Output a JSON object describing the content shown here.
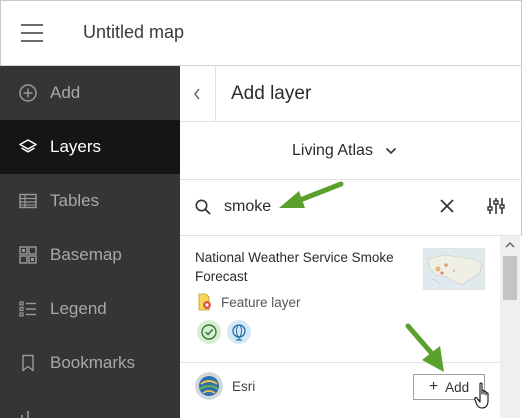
{
  "app": {
    "title": "Untitled map"
  },
  "sidebar": {
    "items": [
      {
        "label": "Add",
        "icon": "add-circle-icon",
        "active": false
      },
      {
        "label": "Layers",
        "icon": "layers-icon",
        "active": true
      },
      {
        "label": "Tables",
        "icon": "table-icon",
        "active": false
      },
      {
        "label": "Basemap",
        "icon": "basemap-icon",
        "active": false
      },
      {
        "label": "Legend",
        "icon": "legend-icon",
        "active": false
      },
      {
        "label": "Bookmarks",
        "icon": "bookmark-icon",
        "active": false
      }
    ]
  },
  "panel": {
    "title": "Add layer",
    "source": "Living Atlas",
    "search": {
      "value": "smoke"
    }
  },
  "results": [
    {
      "title": "National Weather Service Smoke Forecast",
      "type": "Feature layer",
      "owner": "Esri",
      "add_label": "Add"
    }
  ],
  "colors": {
    "sidebar_bg": "#353535",
    "sidebar_active_bg": "#151515",
    "annotation_arrow": "#5aa02c"
  }
}
